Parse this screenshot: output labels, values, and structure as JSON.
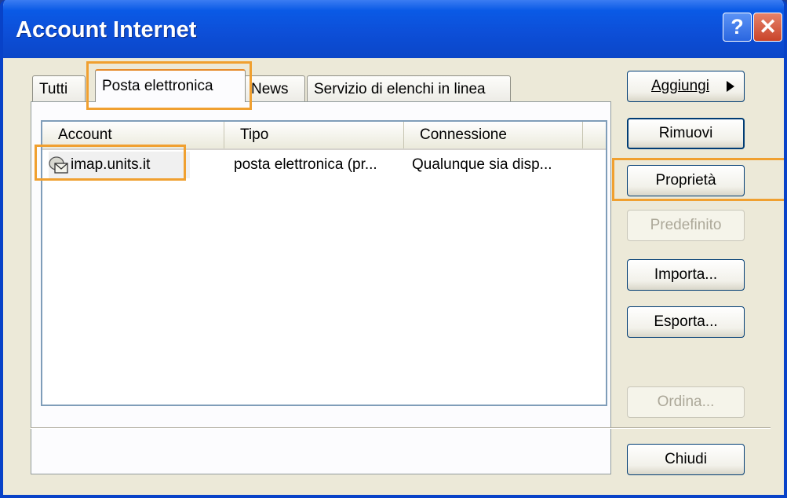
{
  "window": {
    "title": "Account Internet"
  },
  "titlebar": {
    "help_glyph": "?",
    "close_glyph": "✕"
  },
  "tabs": [
    {
      "label": "Tutti",
      "active": false
    },
    {
      "label": "Posta elettronica",
      "active": true
    },
    {
      "label": "News",
      "active": false
    },
    {
      "label": "Servizio di elenchi in linea",
      "active": false
    }
  ],
  "list": {
    "columns": [
      "Account",
      "Tipo",
      "Connessione"
    ],
    "rows": [
      {
        "account": "imap.units.it",
        "tipo": "posta elettronica (pr...",
        "connessione": "Qualunque sia disp...",
        "icon": "mail-account-icon"
      }
    ]
  },
  "buttons": {
    "aggiungi": "Aggiungi",
    "rimuovi": "Rimuovi",
    "proprieta": "Proprietà",
    "predefinito": "Predefinito",
    "importa": "Importa...",
    "esporta": "Esporta...",
    "ordina": "Ordina...",
    "chiudi": "Chiudi"
  },
  "colors": {
    "title_bar": "#0b4fd8",
    "highlight": "#f0a030",
    "window_bg": "#ece9d8"
  }
}
